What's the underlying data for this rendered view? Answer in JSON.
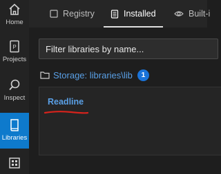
{
  "activity_bar": {
    "items": [
      {
        "label": "Home",
        "icon": "home-icon"
      },
      {
        "label": "Projects",
        "icon": "projects-icon"
      },
      {
        "label": "Inspect",
        "icon": "inspect-icon"
      },
      {
        "label": "Libraries",
        "icon": "libraries-icon",
        "active": true
      },
      {
        "label": "",
        "icon": "boards-icon"
      }
    ]
  },
  "tabs": [
    {
      "label": "Registry",
      "icon": "registry-icon"
    },
    {
      "label": "Installed",
      "icon": "installed-icon",
      "active": true
    },
    {
      "label": "Built-i",
      "icon": "eye-icon"
    }
  ],
  "filter": {
    "placeholder": "Filter libraries by name..."
  },
  "storage": {
    "label": "Storage: libraries\\lib",
    "count": "1"
  },
  "libraries": [
    {
      "name": "Readline"
    }
  ],
  "colors": {
    "accent": "#0e7acc",
    "link": "#5aa0e6",
    "badge": "#1a73d9",
    "annotation": "#d9231c"
  }
}
